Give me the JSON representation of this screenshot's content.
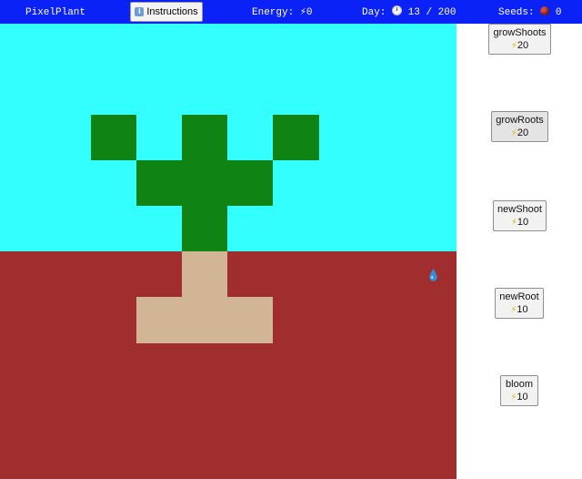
{
  "header": {
    "title": "PixelPlant",
    "instructions_label": "Instructions",
    "energy_label": "Energy:",
    "energy_value": "0",
    "day_label": "Day:",
    "day_current": "13",
    "day_separator": "/",
    "day_total": "200",
    "seeds_label": "Seeds:",
    "seeds_value": "0"
  },
  "actions": [
    {
      "label": "growShoots",
      "cost": "20"
    },
    {
      "label": "growRoots",
      "cost": "20"
    },
    {
      "label": "newShoot",
      "cost": "10"
    },
    {
      "label": "newRoot",
      "cost": "10"
    },
    {
      "label": "bloom",
      "cost": "10"
    }
  ],
  "icons": {
    "energy": "lightning-bolt-icon",
    "day": "clock-icon",
    "seeds": "seed-icon",
    "instructions": "info-icon",
    "cost": "lightning-bolt-icon",
    "water": "water-drop-icon"
  },
  "colors": {
    "topbar": "#0a22f5",
    "sky": "#33ffff",
    "soil": "#a12e2e",
    "shoot": "#0f8415",
    "root": "#d1b594",
    "energy_bolt": "#e8b400"
  }
}
